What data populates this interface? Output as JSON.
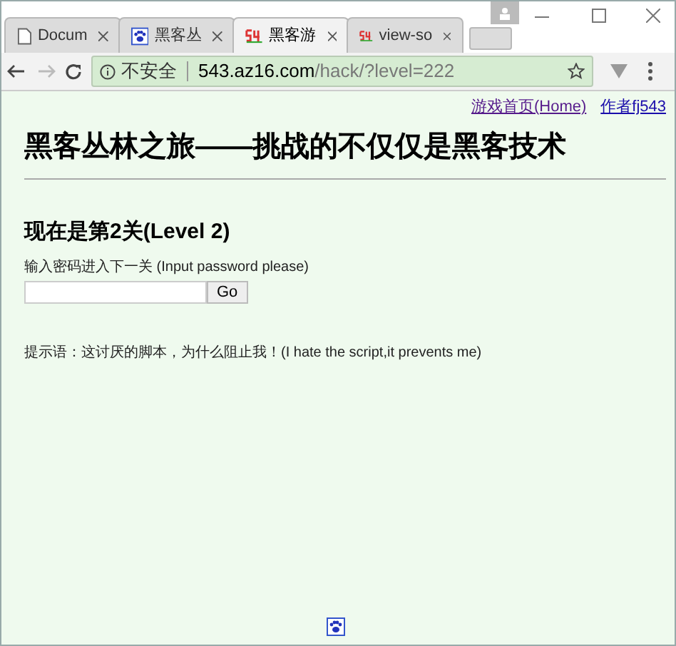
{
  "tabs": [
    {
      "label": "Docum",
      "kind": "document",
      "selected": false
    },
    {
      "label": "黑客丛",
      "kind": "paw",
      "selected": false
    },
    {
      "label": "黑客游",
      "kind": "logo",
      "selected": true
    },
    {
      "label": "view-so",
      "kind": "logo",
      "selected": false
    }
  ],
  "address_bar": {
    "security": "不安全",
    "host": "543.az16.com",
    "path": "/hack/?level=222"
  },
  "page": {
    "top_links": [
      "游戏首页(Home)",
      "作者fj543"
    ],
    "title": "黑客丛林之旅——挑战的不仅仅是黑客技术",
    "level_heading": "现在是第2关(Level 2)",
    "prompt": "输入密码进入下一关 (Input password please)",
    "go_button": "Go",
    "hint": "提示语：这讨厌的脚本，为什么阻止我！(I hate the script,it prevents me)"
  }
}
